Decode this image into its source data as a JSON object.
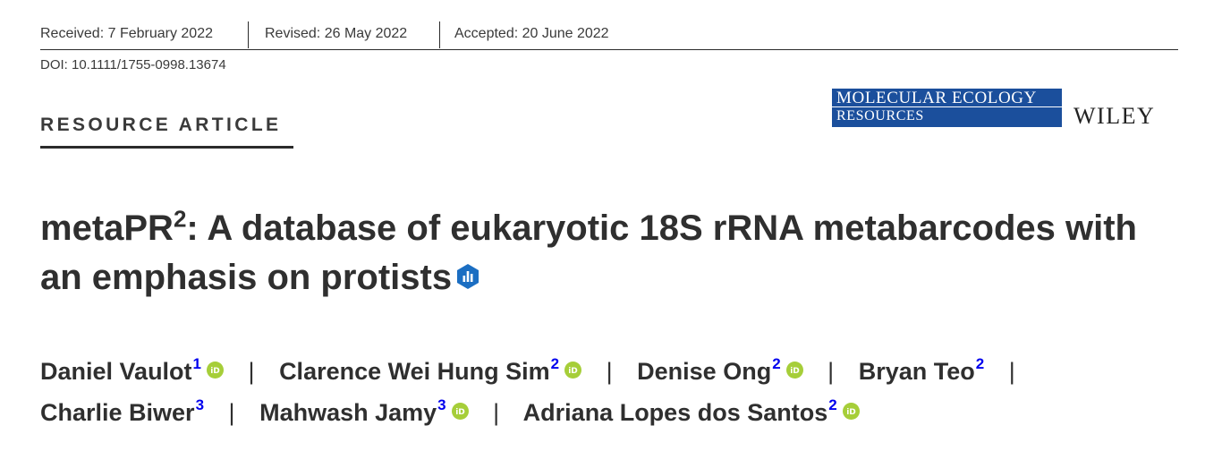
{
  "history": {
    "received": "Received: 7 February 2022",
    "revised": "Revised: 26 May 2022",
    "accepted": "Accepted: 20 June 2022"
  },
  "doi": "DOI: 10.1111/1755-0998.13674",
  "section_type": "RESOURCE ARTICLE",
  "journal": {
    "line1": "MOLECULAR ECOLOGY",
    "line2": "RESOURCES",
    "publisher": "WILEY",
    "brand_color": "#1b4f9c"
  },
  "title": {
    "part1": "metaPR",
    "sup": "2",
    "part2": ": A database of eukaryotic 18S rRNA metabarcodes with an emphasis on protists",
    "badge_icon": "open-data-badge-icon"
  },
  "authors": [
    {
      "name": "Daniel Vaulot",
      "aff": "1",
      "orcid": true
    },
    {
      "name": "Clarence Wei Hung Sim",
      "aff": "2",
      "orcid": true
    },
    {
      "name": "Denise Ong",
      "aff": "2",
      "orcid": true
    },
    {
      "name": "Bryan Teo",
      "aff": "2",
      "orcid": false
    },
    {
      "name": "Charlie Biwer",
      "aff": "3",
      "orcid": false
    },
    {
      "name": "Mahwash Jamy",
      "aff": "3",
      "orcid": true
    },
    {
      "name": "Adriana Lopes dos Santos",
      "aff": "2",
      "orcid": true
    }
  ],
  "author_separator": "|",
  "colors": {
    "orcid": "#a6ce39",
    "affiliation_link": "#0000ee",
    "text": "#2f2f2f"
  }
}
